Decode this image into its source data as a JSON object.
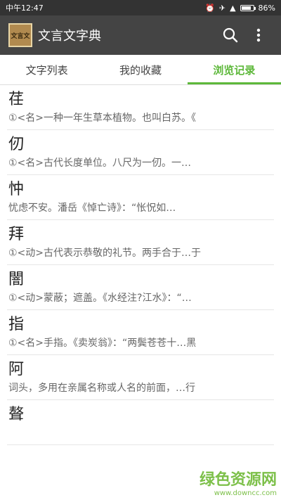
{
  "status": {
    "time": "中午12:47",
    "battery": "86%",
    "battery_level": 0.86
  },
  "app": {
    "logo_text": "文言文",
    "title": "文言文字典"
  },
  "tabs": [
    {
      "label": "文字列表"
    },
    {
      "label": "我的收藏"
    },
    {
      "label": "浏览记录"
    }
  ],
  "items": [
    {
      "char": "荏",
      "def": "①<名>一种一年生草本植物。也叫白苏。《"
    },
    {
      "char": "仞",
      "def": "①<名>古代长度单位。八尺为一仞。一…"
    },
    {
      "char": "忡",
      "def": "忧虑不安。潘岳《悼亡诗》：“怅怳如…"
    },
    {
      "char": "拜",
      "def": "①<动>古代表示恭敬的礼节。两手合于…于"
    },
    {
      "char": "闇",
      "def": "①<动>蒙蔽；遮盖。《水经注?江水》：“…"
    },
    {
      "char": "指",
      "def": "①<名>手指。《卖炭翁》：“两鬓苍苍十…黑"
    },
    {
      "char": "阿",
      "def": "词头，多用在亲属名称或人名的前面，…行"
    },
    {
      "char": "聱",
      "def": ""
    }
  ],
  "watermark": {
    "main": "绿色资源网",
    "sub": "www.downcc.com"
  }
}
